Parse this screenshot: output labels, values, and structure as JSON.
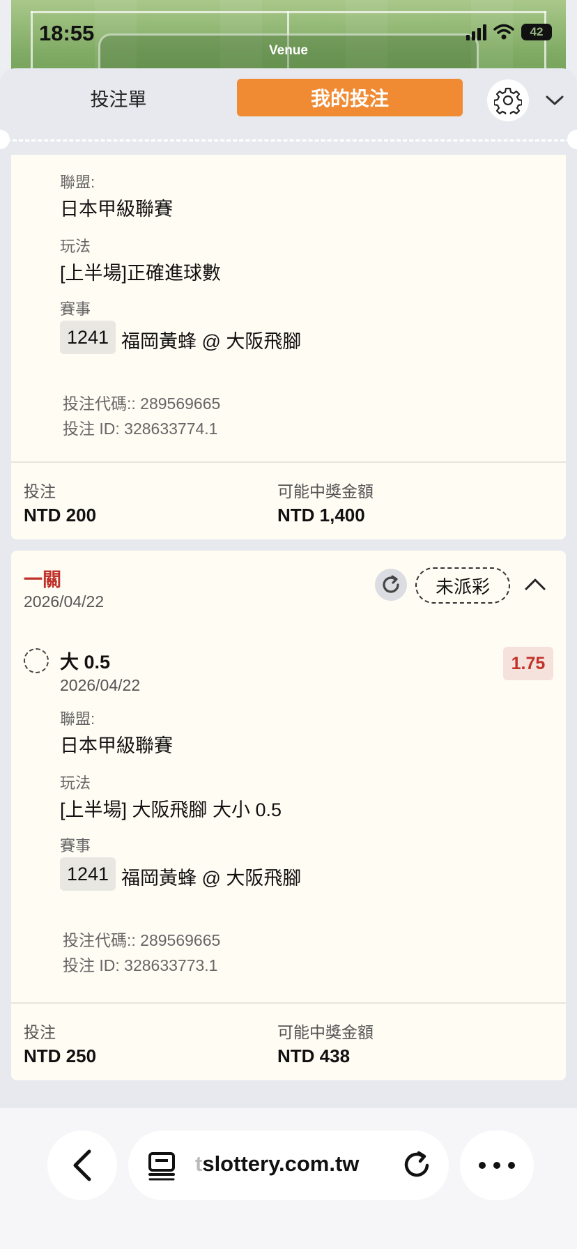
{
  "status_bar": {
    "time": "18:55",
    "battery": "42"
  },
  "header": {
    "venue_label": "Venue"
  },
  "tabs": {
    "betslip": "投注單",
    "my_bets": "我的投注"
  },
  "colors": {
    "accent": "#f08a33",
    "loss_red": "#c0322a",
    "card_bg": "#fffcf4"
  },
  "bet1": {
    "league_label": "聯盟:",
    "league": "日本甲級聯賽",
    "play_label": "玩法",
    "play": "[上半場]正確進球數",
    "event_label": "賽事",
    "match_no": "1241",
    "match": "福岡黃蜂 @ 大阪飛腳",
    "bet_code": "投注代碼:: 289569665",
    "bet_id": "投注 ID: 328633774.1",
    "stake_label": "投注",
    "stake": "NTD 200",
    "payout_label": "可能中獎金額",
    "payout": "NTD 1,400"
  },
  "bet2": {
    "type": "一關",
    "date": "2026/04/22",
    "status": "未派彩",
    "selection": "大 0.5",
    "selection_date": "2026/04/22",
    "odds": "1.75",
    "league_label": "聯盟:",
    "league": "日本甲級聯賽",
    "play_label": "玩法",
    "play": "[上半場] 大阪飛腳 大小 0.5",
    "event_label": "賽事",
    "match_no": "1241",
    "match": "福岡黃蜂 @ 大阪飛腳",
    "bet_code": "投注代碼:: 289569665",
    "bet_id": "投注 ID: 328633773.1",
    "stake_label": "投注",
    "stake": "NTD 250",
    "payout_label": "可能中獎金額",
    "payout": "NTD 438"
  },
  "browser": {
    "host_faded": "t",
    "host": "slottery.com.tw"
  },
  "icons": [
    "gear-icon",
    "chevron-down-icon",
    "refresh-icon",
    "chevron-up-icon",
    "back-icon",
    "tabs-icon",
    "reload-icon",
    "more-icon"
  ]
}
